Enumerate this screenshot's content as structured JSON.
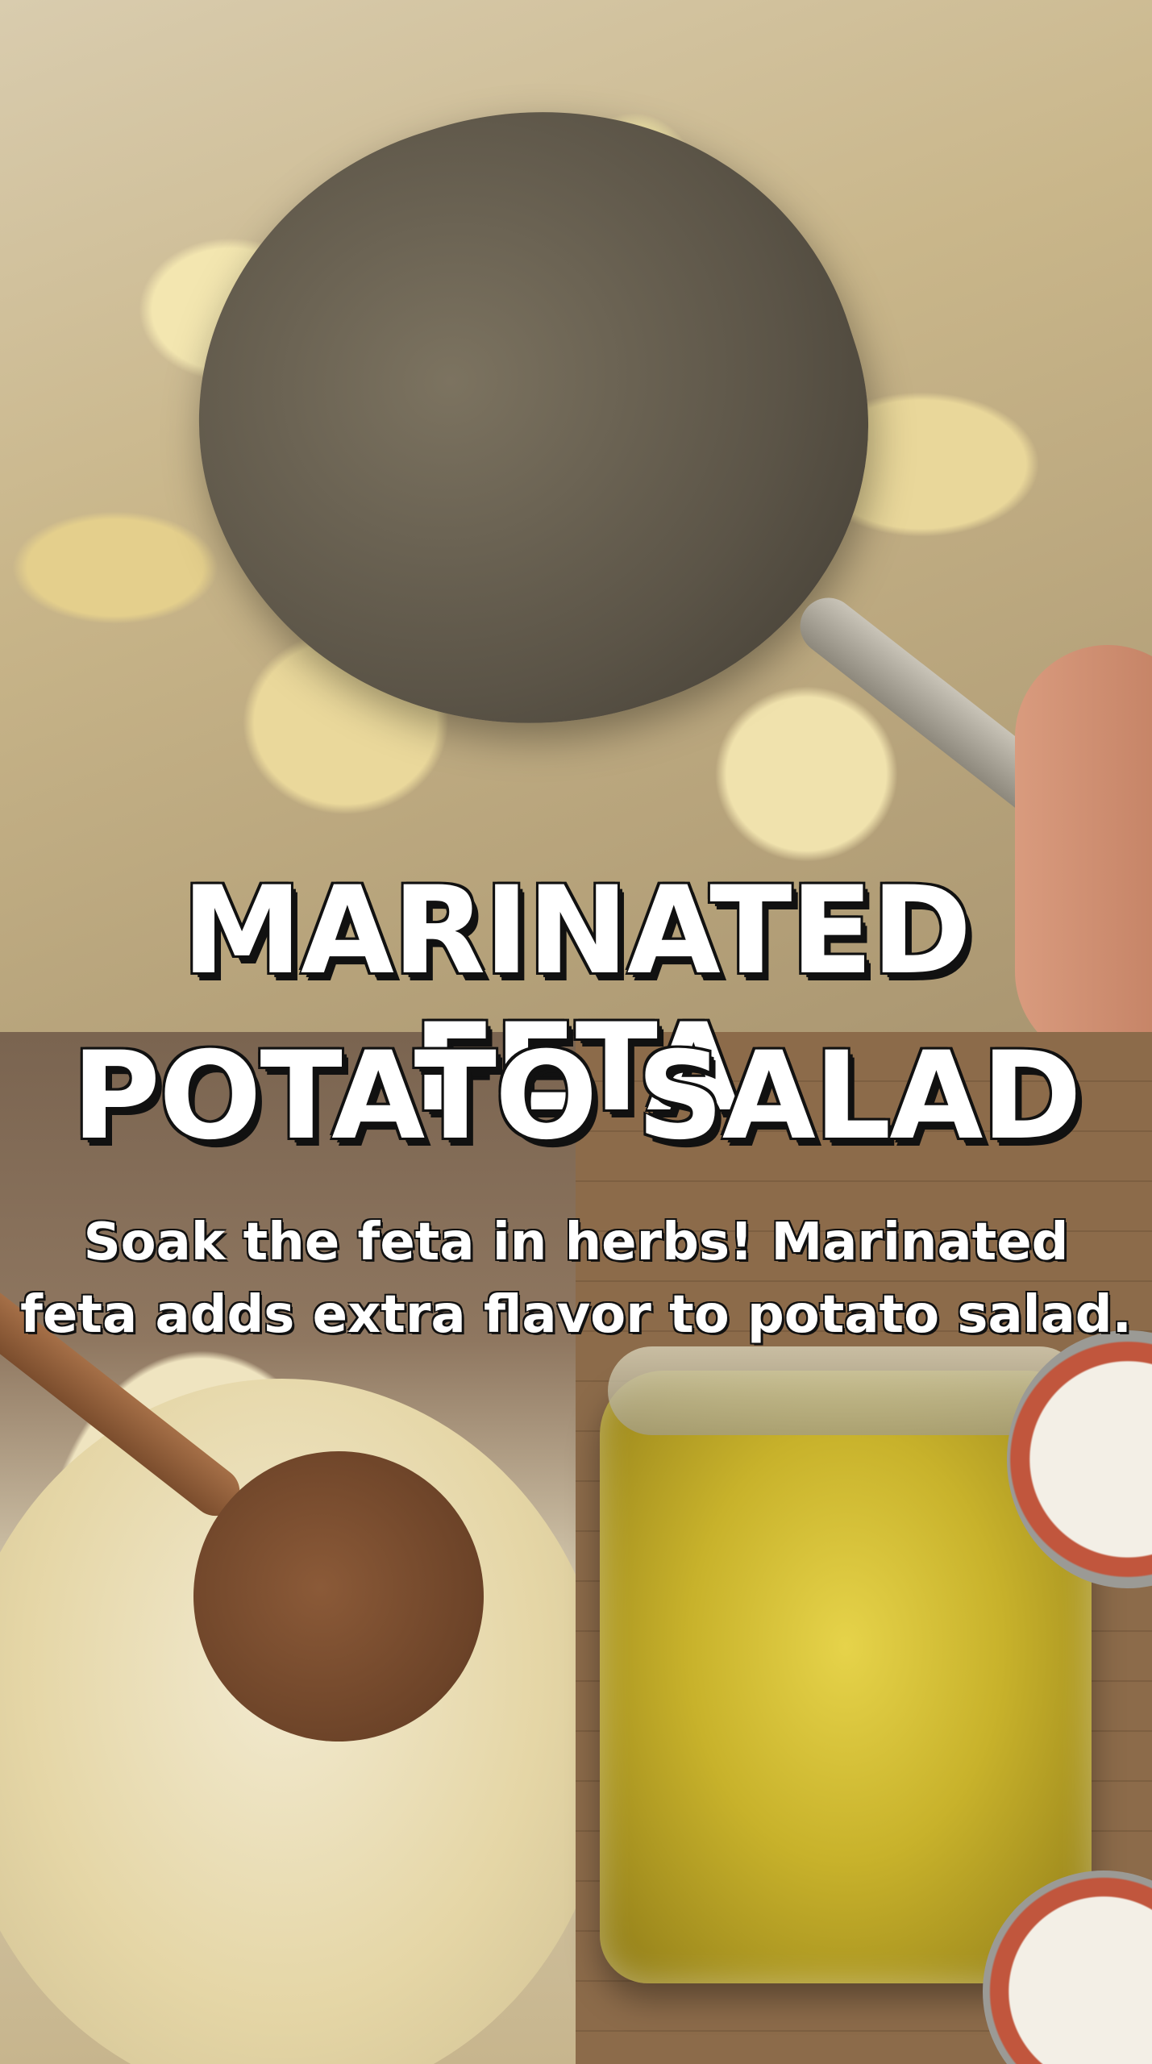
{
  "title": {
    "line1": "MARINATED FETA",
    "line2": "POTATO SALAD"
  },
  "subtitle": {
    "line1": "Soak the feta in herbs! Marinated",
    "line2": "feta adds extra flavor to potato salad."
  },
  "colors": {
    "title_text": "#ffffff",
    "title_outline": "#111111"
  }
}
